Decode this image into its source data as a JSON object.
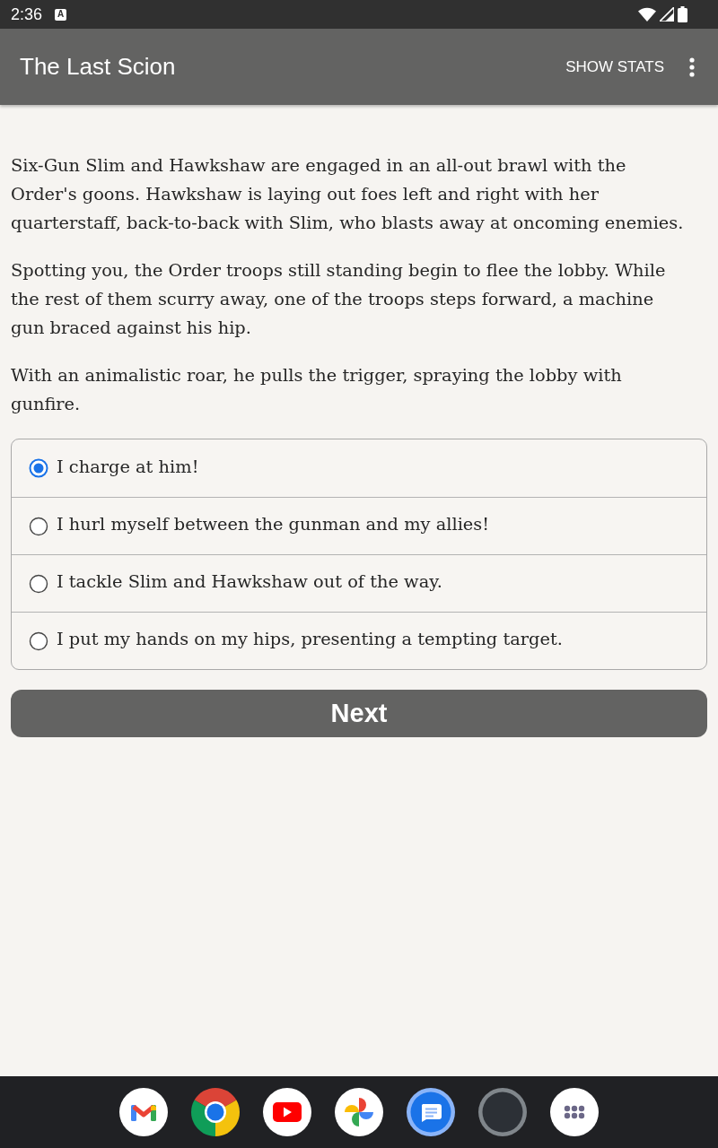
{
  "status_bar": {
    "time": "2:36",
    "notification": "A"
  },
  "app_bar": {
    "title": "The Last Scion",
    "action": "SHOW STATS"
  },
  "story": {
    "paragraphs": [
      "Six-Gun Slim and Hawkshaw are engaged in an all-out brawl with the Order's goons. Hawkshaw is laying out foes left and right with her quarterstaff, back-to-back with Slim, who blasts away at oncoming enemies.",
      "Spotting you, the Order troops still standing begin to flee the lobby. While the rest of them scurry away, one of the troops steps forward, a machine gun braced against his hip.",
      "With an animalistic roar, he pulls the trigger, spraying the lobby with gunfire."
    ]
  },
  "choices": [
    {
      "label": "I charge at him!",
      "selected": true
    },
    {
      "label": "I hurl myself between the gunman and my allies!",
      "selected": false
    },
    {
      "label": "I tackle Slim and Hawkshaw out of the way.",
      "selected": false
    },
    {
      "label": "I put my hands on my hips, presenting a tempting target.",
      "selected": false
    }
  ],
  "next_button": {
    "label": "Next"
  },
  "dock": {
    "apps": [
      {
        "kind": "mail"
      },
      {
        "kind": "browser"
      },
      {
        "kind": "video"
      },
      {
        "kind": "photos"
      },
      {
        "kind": "messages"
      },
      {
        "kind": "avatar"
      },
      {
        "kind": "apps"
      }
    ]
  }
}
